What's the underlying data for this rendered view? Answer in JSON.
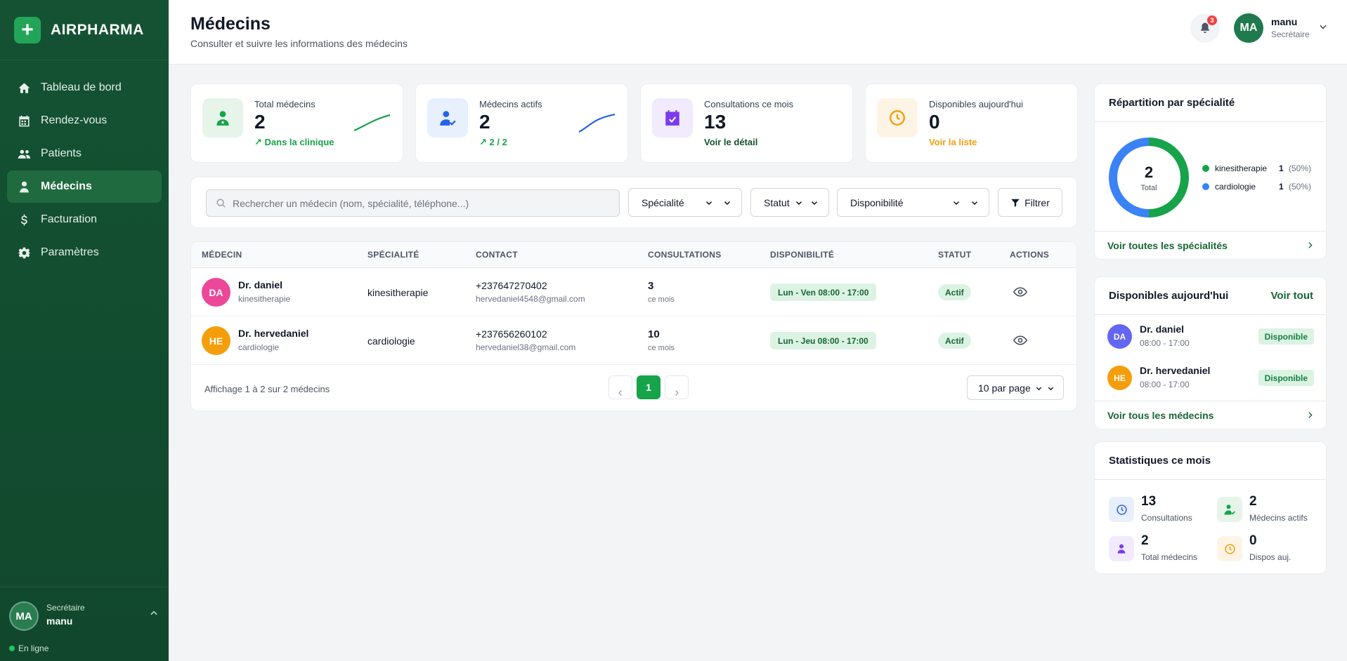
{
  "brand": {
    "name": "AIRPHARMA"
  },
  "sidebar": {
    "items": [
      {
        "label": "Tableau de bord",
        "icon": "home-icon"
      },
      {
        "label": "Rendez-vous",
        "icon": "calendar-icon"
      },
      {
        "label": "Patients",
        "icon": "users-icon"
      },
      {
        "label": "Médecins",
        "icon": "doctor-icon",
        "active": true
      },
      {
        "label": "Facturation",
        "icon": "dollar-icon"
      },
      {
        "label": "Paramètres",
        "icon": "gear-icon"
      }
    ],
    "user": {
      "initials": "MA",
      "role": "Secrétaire",
      "name": "manu",
      "status": "En ligne"
    }
  },
  "header": {
    "title": "Médecins",
    "subtitle": "Consulter et suivre les informations des médecins",
    "notifications": "3",
    "user": {
      "initials": "MA",
      "name": "manu",
      "role": "Secrétaire"
    }
  },
  "stats": [
    {
      "label": "Total médecins",
      "value": "2",
      "foot": "Dans la clinique",
      "color": "#16a34a"
    },
    {
      "label": "Médecins actifs",
      "value": "2",
      "foot": "2 / 2",
      "color": "#2563eb"
    },
    {
      "label": "Consultations ce mois",
      "value": "13",
      "foot": "Voir le détail",
      "color": "#7c3aed"
    },
    {
      "label": "Disponibles aujourd'hui",
      "value": "0",
      "foot": "Voir la liste",
      "color": "#f59e0b"
    }
  ],
  "filters": {
    "search_placeholder": "Rechercher un médecin (nom, spécialité, téléphone...)",
    "specialite": "Spécialité",
    "statut": "Statut",
    "disponibilite": "Disponibilité",
    "filter_button": "Filtrer"
  },
  "table": {
    "headers": [
      "MÉDECIN",
      "SPÉCIALITÉ",
      "CONTACT",
      "CONSULTATIONS",
      "DISPONIBILITÉ",
      "STATUT",
      "ACTIONS"
    ],
    "rows": [
      {
        "initials": "DA",
        "name": "Dr. daniel",
        "specialty": "kinesitherapie",
        "phone": "+237647270402",
        "email": "hervedaniel4548@gmail.com",
        "consultations": "3",
        "consultations_sub": "ce mois",
        "availability": "Lun - Ven 08:00 - 17:00",
        "status": "Actif",
        "color": "#ec4899"
      },
      {
        "initials": "HE",
        "name": "Dr. hervedaniel",
        "specialty": "cardiologie",
        "phone": "+237656260102",
        "email": "hervedaniel38@gmail.com",
        "consultations": "10",
        "consultations_sub": "ce mois",
        "availability": "Lun - Jeu 08:00 - 17:00",
        "status": "Actif",
        "color": "#f59e0b"
      }
    ],
    "footer_text": "Affichage 1 à 2 sur 2 médecins",
    "current_page": "1",
    "per_page": "10 par page"
  },
  "specialty_panel": {
    "title": "Répartition par spécialité",
    "total_value": "2",
    "total_label": "Total",
    "items": [
      {
        "name": "kinesitherapie",
        "count": "1",
        "pct": "(50%)",
        "color": "#16a34a",
        "value": 1
      },
      {
        "name": "cardiologie",
        "count": "1",
        "pct": "(50%)",
        "color": "#3b82f6",
        "value": 1
      }
    ],
    "link": "Voir toutes les spécialités"
  },
  "available_panel": {
    "title": "Disponibles aujourd'hui",
    "see_all": "Voir tout",
    "items": [
      {
        "initials": "DA",
        "name": "Dr. daniel",
        "hours": "08:00 - 17:00",
        "tag": "Disponible",
        "color": "#6366f1"
      },
      {
        "initials": "HE",
        "name": "Dr. hervedaniel",
        "hours": "08:00 - 17:00",
        "tag": "Disponible",
        "color": "#f59e0b"
      }
    ],
    "link": "Voir tous les médecins"
  },
  "month_stats": {
    "title": "Statistiques ce mois",
    "items": [
      {
        "value": "13",
        "label": "Consultations"
      },
      {
        "value": "2",
        "label": "Médecins actifs"
      },
      {
        "value": "2",
        "label": "Total médecins"
      },
      {
        "value": "0",
        "label": "Dispos auj."
      }
    ]
  }
}
